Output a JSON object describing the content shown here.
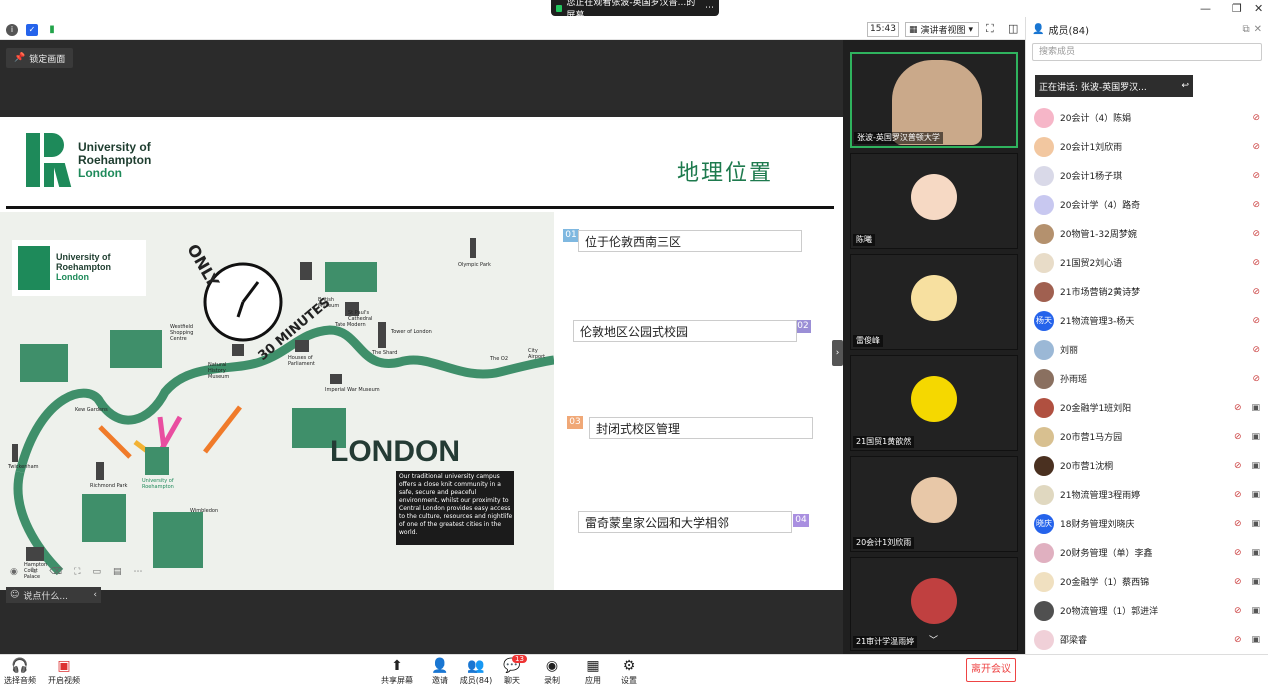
{
  "window": {
    "share_status": "您正在观看张波-英国罗汉普...的屏幕"
  },
  "toolbar": {
    "time": "15:43",
    "view_label": "演讲者视图"
  },
  "main": {
    "lock_label": "锁定画面",
    "chat_placeholder": "说点什么..."
  },
  "slide": {
    "logo": {
      "line1": "University of",
      "line2": "Roehampton",
      "line3": "London"
    },
    "title": "地理位置",
    "items": [
      {
        "num": "01",
        "text": "位于伦敦西南三区",
        "color": "#7fb8e0"
      },
      {
        "num": "02",
        "text": "伦敦地区公园式校园",
        "color": "#9b8fd6"
      },
      {
        "num": "03",
        "text": "封闭式校区管理",
        "color": "#f0a877"
      },
      {
        "num": "04",
        "text": "雷奇蒙皇家公园和大学相邻",
        "color": "#a98fe0"
      }
    ],
    "map": {
      "logo_line1": "University of",
      "logo_line2": "Roehampton",
      "logo_line3": "London",
      "only": "ONLY",
      "minutes": "30 MINUTES",
      "london": "LONDON",
      "blurb": "Our traditional university campus offers a close knit community in a safe, secure and peaceful environment, whilst our proximity to Central London provides easy access to the culture, resources and nightlife of one of the greatest cities in the world.",
      "labels": {
        "olympic": "Olympic Park",
        "airport": "City Airport",
        "o2": "The O2",
        "tower": "Tower of London",
        "shard": "The Shard",
        "tate": "Tate Modern",
        "imperial": "Imperial War Museum",
        "parliament": "Houses of Parliament",
        "westfield": "Westfield Shopping Centre",
        "history": "Natural History Museum",
        "richmond": "Richmond Park",
        "kew": "Kew Gardens",
        "wimbledon": "Wimbledon",
        "twickenham": "Twickenham",
        "campus": "University of Roehampton",
        "british_museum": "British Museum",
        "pauls": "St Paul's Cathedral",
        "hampton": "Hampton Court Palace"
      }
    }
  },
  "video": {
    "tiles": [
      {
        "name": "张波-英国罗汉普顿大学",
        "active": true
      },
      {
        "name": "陈曦",
        "active": false
      },
      {
        "name": "雷俊峰",
        "active": false
      },
      {
        "name": "21国贸1黄歆然",
        "active": false
      },
      {
        "name": "20会计1刘欣雨",
        "active": false
      },
      {
        "name": "21审计学温雨婷",
        "active": false
      }
    ]
  },
  "members": {
    "title": "成员(84)",
    "search_placeholder": "搜索成员",
    "speaking": "正在讲话: 张波-英国罗汉...",
    "list": [
      {
        "name": "20会计（4）陈娟",
        "color": "#f6b6c8"
      },
      {
        "name": "20会计1刘欣雨",
        "color": "#f2c7a0"
      },
      {
        "name": "20会计1杨子琪",
        "color": "#d9d9e8"
      },
      {
        "name": "20会计学（4）路奇",
        "color": "#c8c8f0"
      },
      {
        "name": "20物管1-32周梦婉",
        "color": "#b4916e"
      },
      {
        "name": "21国贸2刘心语",
        "color": "#e8dcc8"
      },
      {
        "name": "21市场营销2黄诗梦",
        "color": "#a06050"
      },
      {
        "name": "21物流管理3-杨天",
        "color": "#2563eb",
        "initials": "杨天"
      },
      {
        "name": "刘丽",
        "color": "#9bb8d6"
      },
      {
        "name": "孙雨瑶",
        "color": "#8a7060"
      },
      {
        "name": "20金融学1班刘阳",
        "color": "#b05040"
      },
      {
        "name": "20市营1马方园",
        "color": "#d8c090"
      },
      {
        "name": "20市营1沈桐",
        "color": "#4a3020"
      },
      {
        "name": "21物流管理3程雨婷",
        "color": "#e0d8c0"
      },
      {
        "name": "18财务管理刘晓庆",
        "color": "#2563eb",
        "initials": "晓庆"
      },
      {
        "name": "20财务管理（单）李鑫",
        "color": "#e0b0c0"
      },
      {
        "name": "20金融学（1）蔡西锦",
        "color": "#f0e0c0"
      },
      {
        "name": "20物流管理（1）郭进洋",
        "color": "#505050"
      },
      {
        "name": "邵梁睿",
        "color": "#f0d0d8"
      }
    ]
  },
  "bottom": {
    "audio": "选择音频",
    "video": "开启视频",
    "share": "共享屏幕",
    "invite": "邀请",
    "members": "成员(84)",
    "chat": "聊天",
    "chat_badge": "13",
    "record": "录制",
    "apps": "应用",
    "settings": "设置",
    "leave": "离开会议"
  }
}
